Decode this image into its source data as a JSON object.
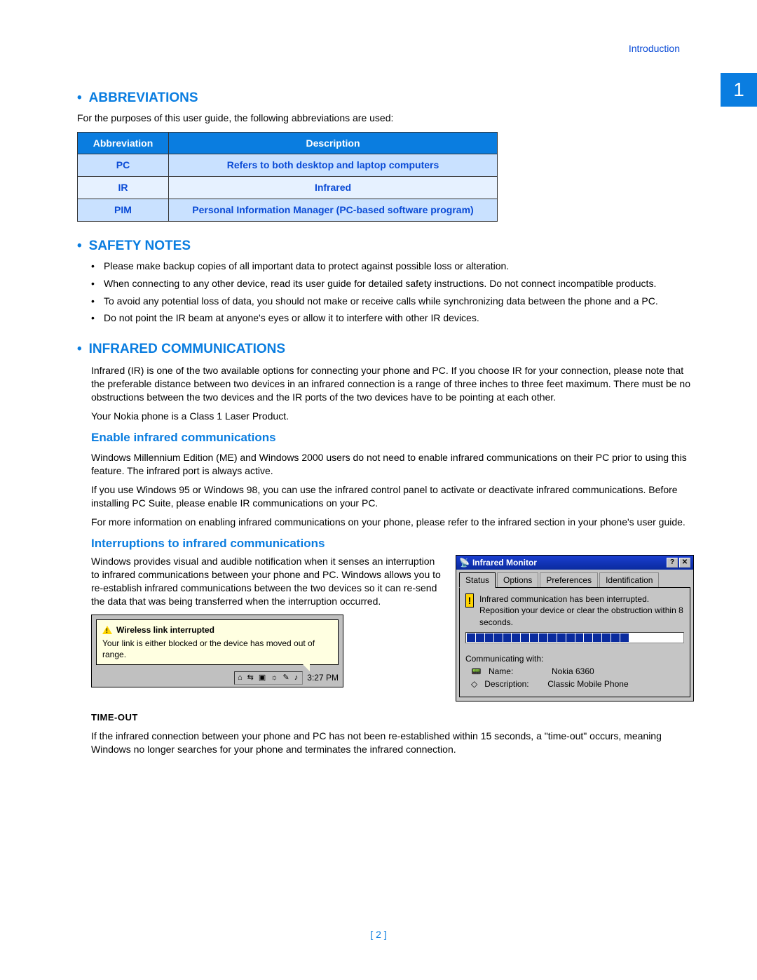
{
  "running_head": "Introduction",
  "page_tab": "1",
  "footer_page": "[ 2 ]",
  "sections": {
    "abbrev_heading": "ABBREVIATIONS",
    "abbrev_intro": "For the purposes of this user guide, the following abbreviations are used:",
    "abbrev_table": {
      "head_abbr": "Abbreviation",
      "head_desc": "Description",
      "rows": [
        {
          "abbr": "PC",
          "desc": "Refers to both desktop and laptop computers"
        },
        {
          "abbr": "IR",
          "desc": "Infrared"
        },
        {
          "abbr": "PIM",
          "desc": "Personal Information Manager (PC-based software program)"
        }
      ]
    },
    "safety_heading": "SAFETY NOTES",
    "safety_items": [
      "Please make backup copies of all important data to protect against possible loss or alteration.",
      "When connecting to any other device, read its user guide for detailed safety instructions. Do not connect incompatible products.",
      "To avoid any potential loss of data, you should not make or receive calls while synchronizing data between the phone and a PC.",
      "Do not point the IR beam at anyone's eyes or allow it to interfere with other IR devices."
    ],
    "ir_heading": "INFRARED COMMUNICATIONS",
    "ir_p1": "Infrared (IR) is one of the two available options for connecting your phone and PC. If you choose IR for your connection, please note that the preferable distance between two devices in an infrared connection is a range of three inches to three feet maximum. There must be no obstructions between the two devices and the IR ports of the two devices have to be pointing at each other.",
    "ir_p2": "Your Nokia phone is a Class 1 Laser Product.",
    "enable_heading": "Enable infrared communications",
    "enable_p1": "Windows Millennium Edition (ME) and Windows 2000 users do not need to enable infrared communications on their PC prior to using this feature. The infrared port is always active.",
    "enable_p2": "If you use Windows 95 or Windows 98, you can use the infrared control panel to activate or deactivate infrared communications. Before installing PC Suite, please enable IR communications on your PC.",
    "enable_p3": "For more information on enabling infrared communications on your phone, please refer to the infrared section in your phone's user guide.",
    "interrupt_heading": "Interruptions to infrared communications",
    "interrupt_p": "Windows provides visual and audible notification when it senses an interruption to infrared communications between your phone and PC. Windows allows you to re-establish infrared communications between the two devices so it can re-send the data that was being transferred when the interruption occurred.",
    "tooltip": {
      "title": "Wireless link interrupted",
      "body": "Your link is either blocked or the device has moved out of range.",
      "tray_icons": "⌂ ⇆ ▣ ☼ ✎ ♪",
      "time": "3:27 PM"
    },
    "timeout_heading": "TIME-OUT",
    "timeout_p": "If the infrared connection between your phone and PC has not been re-established within 15 seconds, a \"time-out\" occurs, meaning Windows no longer searches for your phone and terminates the infrared connection."
  },
  "ir_monitor": {
    "title": "Infrared Monitor",
    "help_btn": "?",
    "close_btn": "✕",
    "tabs": [
      "Status",
      "Options",
      "Preferences",
      "Identification"
    ],
    "msg": "Infrared communication has been interrupted. Reposition your device or clear the obstruction within 8 seconds.",
    "comm_label": "Communicating with:",
    "name_key": "Name:",
    "name_val": "Nokia 6360",
    "desc_key": "Description:",
    "desc_val": "Classic Mobile Phone"
  }
}
